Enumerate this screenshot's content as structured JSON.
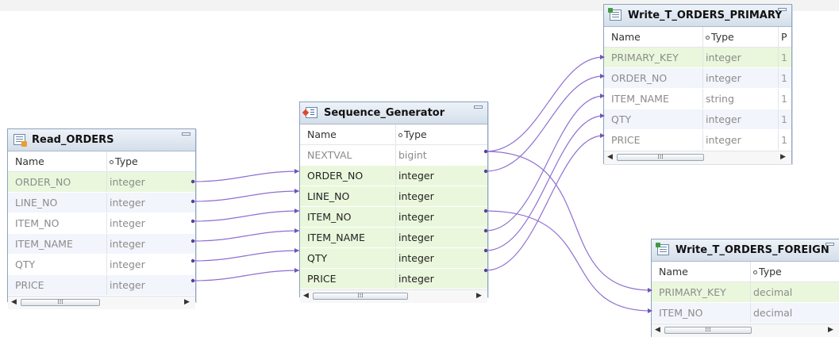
{
  "read_orders": {
    "title": "Read_ORDERS",
    "header": {
      "name": "Name",
      "type": "Type"
    },
    "rows": [
      {
        "name": "ORDER_NO",
        "type": "integer"
      },
      {
        "name": "LINE_NO",
        "type": "integer"
      },
      {
        "name": "ITEM_NO",
        "type": "integer"
      },
      {
        "name": "ITEM_NAME",
        "type": "integer"
      },
      {
        "name": "QTY",
        "type": "integer"
      },
      {
        "name": "PRICE",
        "type": "integer"
      }
    ]
  },
  "sequence_generator": {
    "title": "Sequence_Generator",
    "header": {
      "name": "Name",
      "type": "Type"
    },
    "rows": [
      {
        "name": "NEXTVAL",
        "type": "bigint"
      },
      {
        "name": "ORDER_NO",
        "type": "integer"
      },
      {
        "name": "LINE_NO",
        "type": "integer"
      },
      {
        "name": "ITEM_NO",
        "type": "integer"
      },
      {
        "name": "ITEM_NAME",
        "type": "integer"
      },
      {
        "name": "QTY",
        "type": "integer"
      },
      {
        "name": "PRICE",
        "type": "integer"
      }
    ]
  },
  "write_primary": {
    "title": "Write_T_ORDERS_PRIMARY",
    "header": {
      "name": "Name",
      "type": "Type",
      "extra": "P"
    },
    "rows": [
      {
        "name": "PRIMARY_KEY",
        "type": "integer",
        "extra": "1"
      },
      {
        "name": "ORDER_NO",
        "type": "integer",
        "extra": "1"
      },
      {
        "name": "ITEM_NAME",
        "type": "string",
        "extra": "1"
      },
      {
        "name": "QTY",
        "type": "integer",
        "extra": "1"
      },
      {
        "name": "PRICE",
        "type": "integer",
        "extra": "1"
      }
    ]
  },
  "write_foreign": {
    "title": "Write_T_ORDERS_FOREIGN",
    "header": {
      "name": "Name",
      "type": "Type"
    },
    "rows": [
      {
        "name": "PRIMARY_KEY",
        "type": "decimal"
      },
      {
        "name": "ITEM_NO",
        "type": "decimal"
      }
    ]
  },
  "icons": {
    "read": "source-table-icon",
    "sequence": "sequence-generator-icon",
    "write": "target-table-icon",
    "minimize": "minimize-icon"
  },
  "colors": {
    "link": "#8f6fd2",
    "row_green": "#eaf7dc",
    "title_bar": "#d4deea"
  }
}
